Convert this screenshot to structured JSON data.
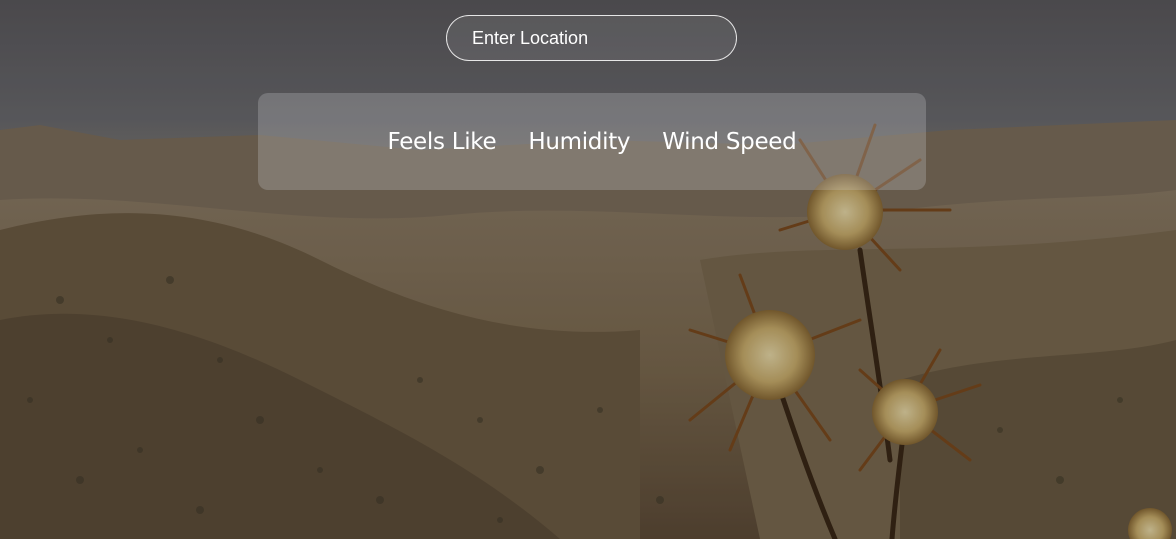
{
  "search": {
    "placeholder": "Enter Location"
  },
  "weather_card": {
    "labels": [
      "Feels Like",
      "Humidity",
      "Wind Speed"
    ]
  },
  "colors": {
    "text": "#ffffff",
    "card_background": "rgba(200,200,205,0.28)",
    "sky": "#5f5c5f",
    "hills": "#7a6a52"
  },
  "background": {
    "subject": "thistle flowers over mountain valley"
  }
}
